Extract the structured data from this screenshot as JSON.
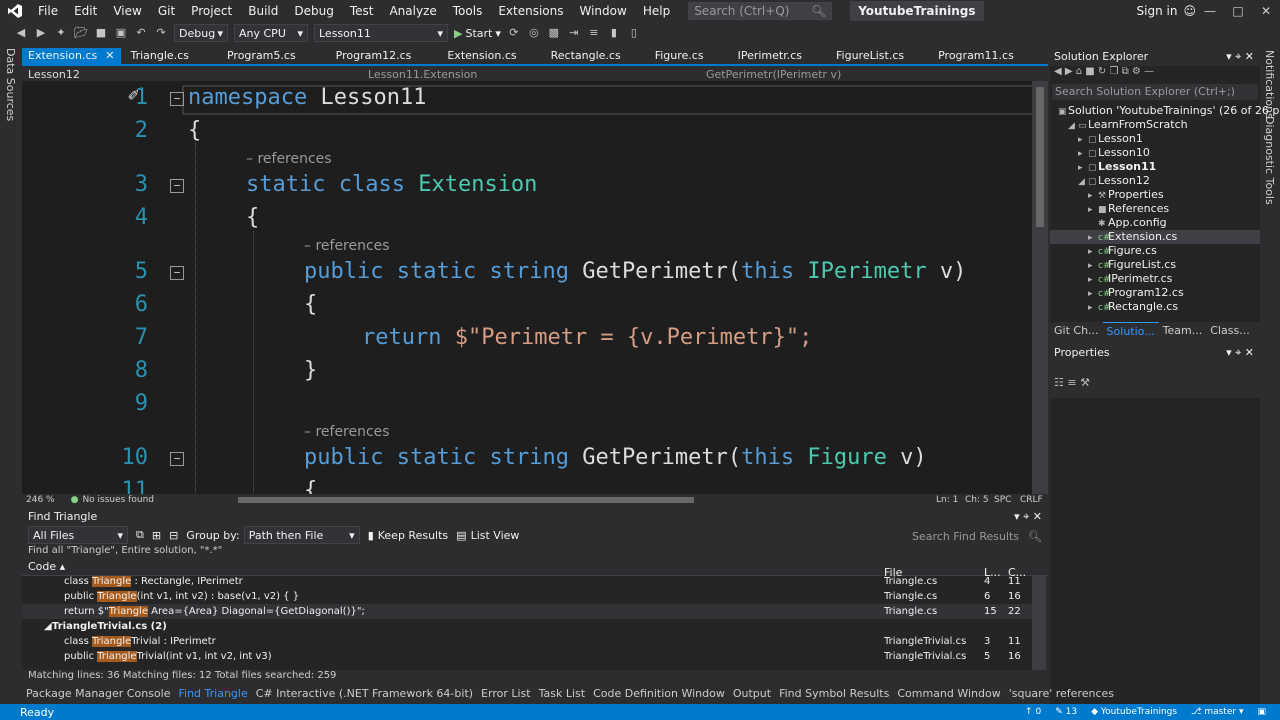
{
  "menubar": {
    "items": [
      "File",
      "Edit",
      "View",
      "Git",
      "Project",
      "Build",
      "Debug",
      "Test",
      "Analyze",
      "Tools",
      "Extensions",
      "Window",
      "Help"
    ],
    "search_placeholder": "Search (Ctrl+Q)",
    "solution_name": "YoutubeTrainings",
    "signin_label": "Sign in"
  },
  "toolbar": {
    "config": "Debug",
    "platform": "Any CPU",
    "startup_project": "Lesson11",
    "start_label": "Start"
  },
  "left_strip": {
    "data_sources_label": "Data Sources"
  },
  "right_strip": {
    "notifications_label": "Notifications",
    "diagnostic_label": "Diagnostic Tools"
  },
  "editor_tabs": [
    {
      "label": "Extension.cs",
      "active": true
    },
    {
      "label": "Triangle.cs"
    },
    {
      "label": "Program5.cs"
    },
    {
      "label": "Program12.cs"
    },
    {
      "label": "Extension.cs"
    },
    {
      "label": "Rectangle.cs"
    },
    {
      "label": "Figure.cs"
    },
    {
      "label": "IPerimetr.cs"
    },
    {
      "label": "FigureList.cs"
    },
    {
      "label": "Program11.cs"
    }
  ],
  "navbar": {
    "project": "Lesson12",
    "class": "Lesson11.Extension",
    "member": "GetPerimetr(IPerimetr v)"
  },
  "code": {
    "line_numbers": [
      "1",
      "2",
      "3",
      "4",
      "5",
      "6",
      "7",
      "8",
      "9",
      "10",
      "11"
    ],
    "references_label": "– references",
    "ns_kw": "namespace",
    "ns_name": "Lesson11",
    "open_brace": "{",
    "close_brace": "}",
    "static_kw": "static",
    "class_kw": "class",
    "class_name": "Extension",
    "public_kw": "public",
    "string_kw": "string",
    "method_name": "GetPerimetr(",
    "this_kw": "this",
    "type1": "IPerimetr",
    "type2": "Figure",
    "param": " v)",
    "return_kw": "return",
    "return_str": "$\"Perimetr = {v.Perimetr}\";"
  },
  "editor_status": {
    "zoom": "246 %",
    "issues": "No issues found",
    "ln": "Ln: 1",
    "ch": "Ch: 5",
    "spc": "SPC",
    "crlf": "CRLF"
  },
  "solution_explorer": {
    "title": "Solution Explorer",
    "search_placeholder": "Search Solution Explorer (Ctrl+;)",
    "items": [
      {
        "label": "Solution 'YoutubeTrainings' (26 of 26 p",
        "indent": 0
      },
      {
        "label": "LearnFromScratch",
        "indent": 1
      },
      {
        "label": "Lesson1",
        "indent": 2
      },
      {
        "label": "Lesson10",
        "indent": 2
      },
      {
        "label": "Lesson11",
        "indent": 2,
        "bold": true
      },
      {
        "label": "Lesson12",
        "indent": 2
      },
      {
        "label": "Properties",
        "indent": 3
      },
      {
        "label": "References",
        "indent": 3
      },
      {
        "label": "App.config",
        "indent": 3
      },
      {
        "label": "Extension.cs",
        "indent": 3,
        "selected": true
      },
      {
        "label": "Figure.cs",
        "indent": 3
      },
      {
        "label": "FigureList.cs",
        "indent": 3
      },
      {
        "label": "IPerimetr.cs",
        "indent": 3
      },
      {
        "label": "Program12.cs",
        "indent": 3
      },
      {
        "label": "Rectangle.cs",
        "indent": 3
      }
    ],
    "tabs": [
      "Git Ch...",
      "Solutio...",
      "Team...",
      "Class..."
    ]
  },
  "properties": {
    "title": "Properties"
  },
  "find_panel": {
    "title": "Find Triangle",
    "scope": "All Files",
    "group_by_label": "Group by:",
    "group_by_value": "Path then File",
    "keep_results": "Keep Results",
    "list_view": "List View",
    "search_placeholder": "Search Find Results",
    "summary": "Find all \"Triangle\", Entire solution, \"*.*\"",
    "col_code": "Code",
    "col_file": "File",
    "col_line": "L...",
    "col_col": "C...",
    "rows": [
      {
        "pre": "class ",
        "hl": "Triangle",
        "post": " : Rectangle, IPerimetr",
        "file": "Triangle.cs",
        "line": "4",
        "col": "11"
      },
      {
        "pre": "public ",
        "hl": "Triangle",
        "post": "(int v1, int v2) : base(v1, v2) { }",
        "file": "Triangle.cs",
        "line": "6",
        "col": "16"
      },
      {
        "pre": "return $\"",
        "hl": "Triangle",
        "post": " Area={Area} Diagonal={GetDiagonal()}\";",
        "file": "Triangle.cs",
        "line": "15",
        "col": "22"
      },
      {
        "group": "TriangleTrivial.cs (2)"
      },
      {
        "pre": "class ",
        "hl": "Triangle",
        "post": "Trivial : IPerimetr",
        "file": "TriangleTrivial.cs",
        "line": "3",
        "col": "11"
      },
      {
        "pre": "public ",
        "hl": "Triangle",
        "post": "Trivial(int v1, int v2, int v3)",
        "file": "TriangleTrivial.cs",
        "line": "5",
        "col": "16"
      }
    ],
    "status": "Matching lines: 36 Matching files: 12 Total files searched: 259"
  },
  "tool_tabs": [
    {
      "label": "Package Manager Console"
    },
    {
      "label": "Find Triangle",
      "active": true
    },
    {
      "label": "C# Interactive (.NET Framework 64-bit)"
    },
    {
      "label": "Error List"
    },
    {
      "label": "Task List"
    },
    {
      "label": "Code Definition Window"
    },
    {
      "label": "Output"
    },
    {
      "label": "Find Symbol Results"
    },
    {
      "label": "Command Window"
    },
    {
      "label": "'square' references"
    }
  ],
  "statusbar": {
    "ready": "Ready",
    "errors": "0",
    "commits": "13",
    "repo": "YoutubeTrainings",
    "branch": "master"
  }
}
